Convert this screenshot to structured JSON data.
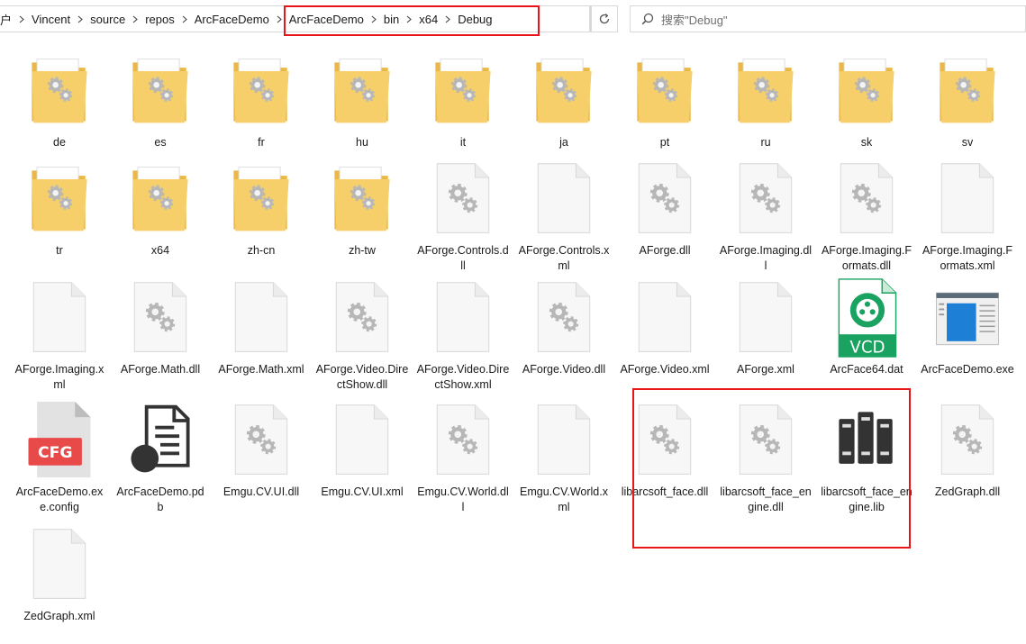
{
  "breadcrumbs": [
    "户",
    "Vincent",
    "source",
    "repos",
    "ArcFaceDemo",
    "ArcFaceDemo",
    "bin",
    "x64",
    "Debug"
  ],
  "search": {
    "placeholder": "搜索\"Debug\""
  },
  "icon_names": {
    "folder": "folder-icon",
    "gear_file": "settings-file-icon",
    "blank_file": "blank-file-icon",
    "vcd": "vcd-file-icon",
    "exe": "app-window-icon",
    "cfg": "cfg-file-icon",
    "pdb": "pdb-file-icon",
    "lib": "library-books-icon"
  },
  "colors": {
    "highlight": "#e8141a",
    "folder": "#f6cf6b",
    "vcd": "#1aa260",
    "cfg": "#e84a4a"
  },
  "files": [
    {
      "name": "de",
      "type": "folder"
    },
    {
      "name": "es",
      "type": "folder"
    },
    {
      "name": "fr",
      "type": "folder"
    },
    {
      "name": "hu",
      "type": "folder"
    },
    {
      "name": "it",
      "type": "folder"
    },
    {
      "name": "ja",
      "type": "folder"
    },
    {
      "name": "pt",
      "type": "folder"
    },
    {
      "name": "ru",
      "type": "folder"
    },
    {
      "name": "sk",
      "type": "folder"
    },
    {
      "name": "sv",
      "type": "folder"
    },
    {
      "name": "tr",
      "type": "folder"
    },
    {
      "name": "x64",
      "type": "folder"
    },
    {
      "name": "zh-cn",
      "type": "folder"
    },
    {
      "name": "zh-tw",
      "type": "folder"
    },
    {
      "name": "AForge.Controls.dll",
      "type": "gear"
    },
    {
      "name": "AForge.Controls.xml",
      "type": "blank"
    },
    {
      "name": "AForge.dll",
      "type": "gear"
    },
    {
      "name": "AForge.Imaging.dll",
      "type": "gear"
    },
    {
      "name": "AForge.Imaging.Formats.dll",
      "type": "gear"
    },
    {
      "name": "AForge.Imaging.Formats.xml",
      "type": "blank"
    },
    {
      "name": "AForge.Imaging.xml",
      "type": "blank"
    },
    {
      "name": "AForge.Math.dll",
      "type": "gear"
    },
    {
      "name": "AForge.Math.xml",
      "type": "blank"
    },
    {
      "name": "AForge.Video.DirectShow.dll",
      "type": "gear"
    },
    {
      "name": "AForge.Video.DirectShow.xml",
      "type": "blank"
    },
    {
      "name": "AForge.Video.dll",
      "type": "gear"
    },
    {
      "name": "AForge.Video.xml",
      "type": "blank"
    },
    {
      "name": "AForge.xml",
      "type": "blank"
    },
    {
      "name": "ArcFace64.dat",
      "type": "vcd",
      "badge": "VCD"
    },
    {
      "name": "ArcFaceDemo.exe",
      "type": "exe"
    },
    {
      "name": "ArcFaceDemo.exe.config",
      "type": "cfg",
      "badge": "CFG"
    },
    {
      "name": "ArcFaceDemo.pdb",
      "type": "pdb"
    },
    {
      "name": "Emgu.CV.UI.dll",
      "type": "gear"
    },
    {
      "name": "Emgu.CV.UI.xml",
      "type": "blank"
    },
    {
      "name": "Emgu.CV.World.dll",
      "type": "gear"
    },
    {
      "name": "Emgu.CV.World.xml",
      "type": "blank"
    },
    {
      "name": "libarcsoft_face.dll",
      "type": "gear"
    },
    {
      "name": "libarcsoft_face_engine.dll",
      "type": "gear"
    },
    {
      "name": "libarcsoft_face_engine.lib",
      "type": "lib"
    },
    {
      "name": "ZedGraph.dll",
      "type": "gear"
    },
    {
      "name": "ZedGraph.xml",
      "type": "blank"
    }
  ]
}
